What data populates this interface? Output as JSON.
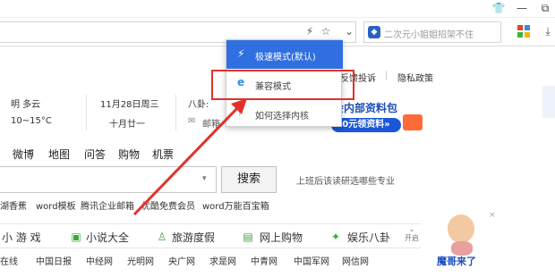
{
  "browser": {
    "search_placeholder": "二次元小姐姐招架不住"
  },
  "popup": {
    "items": [
      {
        "label": "极速模式(默认)"
      },
      {
        "label": "兼容模式"
      },
      {
        "label": "如何选择内核"
      }
    ]
  },
  "toolbar_links": [
    "反馈投诉",
    "隐私政策"
  ],
  "weather": {
    "condition": "明 多云",
    "temp": "10~15°C",
    "date": "11月28日周三",
    "lunar": "十月廿一",
    "bagua_label": "八卦:",
    "mail_label": "邮箱"
  },
  "banner": {
    "line1": "生会内部资料包",
    "button": "0元领资料»"
  },
  "nav_tabs": [
    "微博",
    "地图",
    "问答",
    "购物",
    "机票"
  ],
  "search": {
    "button": "搜索",
    "hint": "上班后该读研选哪些专业"
  },
  "quick_links": [
    "湖香蕉",
    "word模板",
    "腾讯企业邮箱",
    "优酷免费会员",
    "word万能百宝箱"
  ],
  "categories": [
    {
      "icon": "game-icon",
      "label": "小 游 戏"
    },
    {
      "icon": "book-icon",
      "label": "小说大全"
    },
    {
      "icon": "travel-icon",
      "label": "旅游度假"
    },
    {
      "icon": "cart-icon",
      "label": "网上购物"
    },
    {
      "icon": "star-icon",
      "label": "娱乐八卦"
    }
  ],
  "expand_label": "开启",
  "sites": [
    "在线",
    "中国日报",
    "中经网",
    "光明网",
    "央广网",
    "求是网",
    "中青网",
    "中国军网",
    "网信网"
  ],
  "mascot_text": "魔哥来了",
  "colors": {
    "popup_header": "#2f6fe0",
    "highlight": "#e0322b",
    "banner_blue": "#1c58d6"
  }
}
